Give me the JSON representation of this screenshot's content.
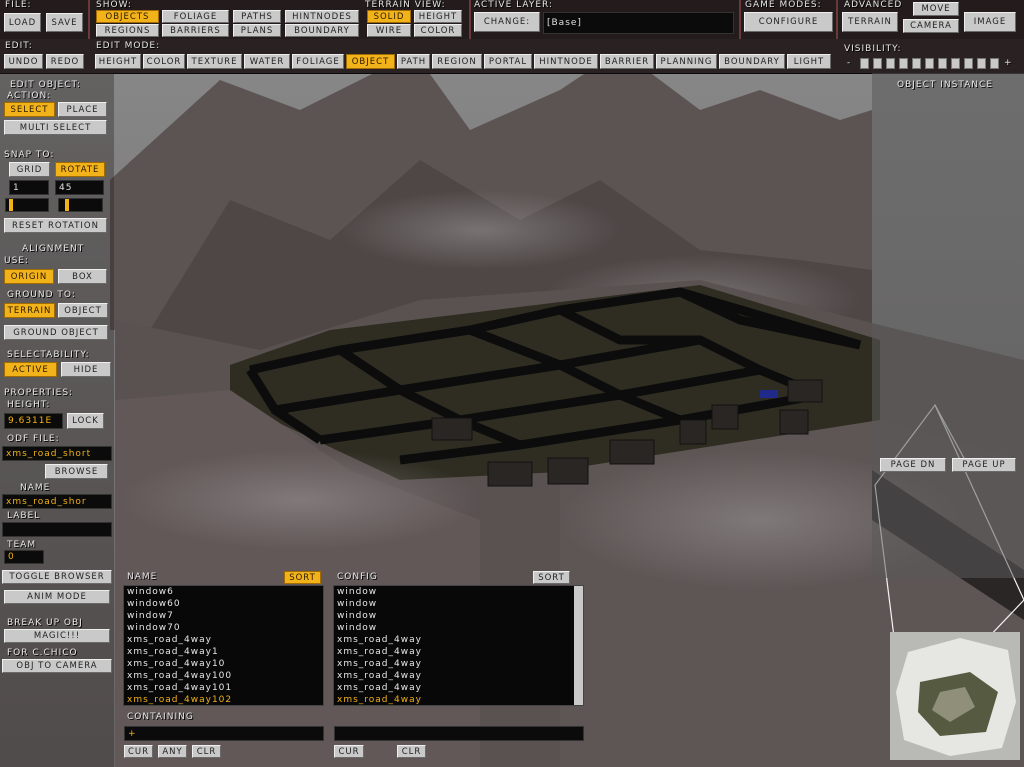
{
  "file": {
    "label": "File:",
    "load": "Load",
    "save": "Save"
  },
  "show": {
    "label": "Show:",
    "objects": "Objects",
    "foliage": "Foliage",
    "paths": "Paths",
    "hintnodes": "HintNodes",
    "regions": "Regions",
    "barriers": "Barriers",
    "plans": "Plans",
    "boundary": "Boundary"
  },
  "terrain_view": {
    "label": "Terrain View:",
    "solid": "Solid",
    "height": "Height",
    "wire": "Wire",
    "color": "Color"
  },
  "active_layer": {
    "label": "Active Layer:",
    "change": "Change:",
    "value": "[Base]"
  },
  "game_modes": {
    "label": "Game Modes:",
    "configure": "Configure"
  },
  "advanced": {
    "label": "Advanced",
    "terrain": "Terrain",
    "move": "Move",
    "camera": "Camera",
    "image": "Image"
  },
  "edit": {
    "label": "Edit:",
    "undo": "Undo",
    "redo": "Redo"
  },
  "edit_mode": {
    "label": "Edit Mode:",
    "modes": [
      "Height",
      "Color",
      "Texture",
      "Water",
      "Foliage",
      "Object",
      "Path",
      "Region",
      "Portal",
      "HintNode",
      "Barrier",
      "Planning",
      "Boundary",
      "Light"
    ],
    "active": "Object"
  },
  "visibility": {
    "label": "Visibility:",
    "minus": "-",
    "plus": "+"
  },
  "left": {
    "edit_object": "Edit Object:",
    "action": "Action:",
    "select": "Select",
    "place": "Place",
    "multi_select": "Multi Select",
    "snap_to": "Snap To:",
    "grid": "Grid",
    "rotate": "Rotate",
    "grid_value": "1",
    "rotate_value": "45",
    "reset_rotation": "Reset Rotation",
    "alignment": "Alignment",
    "use": "Use:",
    "origin": "Origin",
    "box": "Box",
    "ground_to": "Ground To:",
    "terrain": "Terrain",
    "object": "Object",
    "ground_object": "Ground Object",
    "selectability": "Selectability:",
    "active": "Active",
    "hide": "Hide",
    "properties": "Properties:",
    "height": "Height:",
    "height_value": "9.6311E",
    "lock": "Lock",
    "odf_file": "Odf File:",
    "odf_value": "xms_road_short",
    "browse": "Browse",
    "name": "Name",
    "name_value": "xms_road_shor",
    "label": "Label",
    "label_value": "",
    "team": "Team",
    "team_value": "0",
    "toggle_browser": "Toggle Browser",
    "anim_mode": "Anim Mode",
    "break_up": "Break Up Obj",
    "magic": "Magic!!!",
    "for_chico": "For C.Chico",
    "obj_to_camera": "Obj To Camera"
  },
  "right": {
    "object_instance": "Object Instance",
    "page_dn": "Page Dn",
    "page_up": "Page Up"
  },
  "browser": {
    "name_header": "Name",
    "name_sort": "Sort",
    "config_header": "Config",
    "config_sort": "Sort",
    "names": [
      "window6",
      "window60",
      "window7",
      "window70",
      "xms_road_4way",
      "xms_road_4way1",
      "xms_road_4way10",
      "xms_road_4way100",
      "xms_road_4way101",
      "xms_road_4way102"
    ],
    "configs": [
      "window",
      "window",
      "window",
      "window",
      "xms_road_4way",
      "xms_road_4way",
      "xms_road_4way",
      "xms_road_4way",
      "xms_road_4way",
      "xms_road_4way"
    ],
    "containing": "Containing",
    "containing_value": "+",
    "config_filter_value": "",
    "cur": "Cur",
    "any": "Any",
    "clr": "Clr",
    "cur2": "Cur",
    "clr2": "Clr"
  },
  "colors": {
    "accent": "#f2b21a",
    "button": "#c9c9c9",
    "topbar": "#241c1c"
  }
}
